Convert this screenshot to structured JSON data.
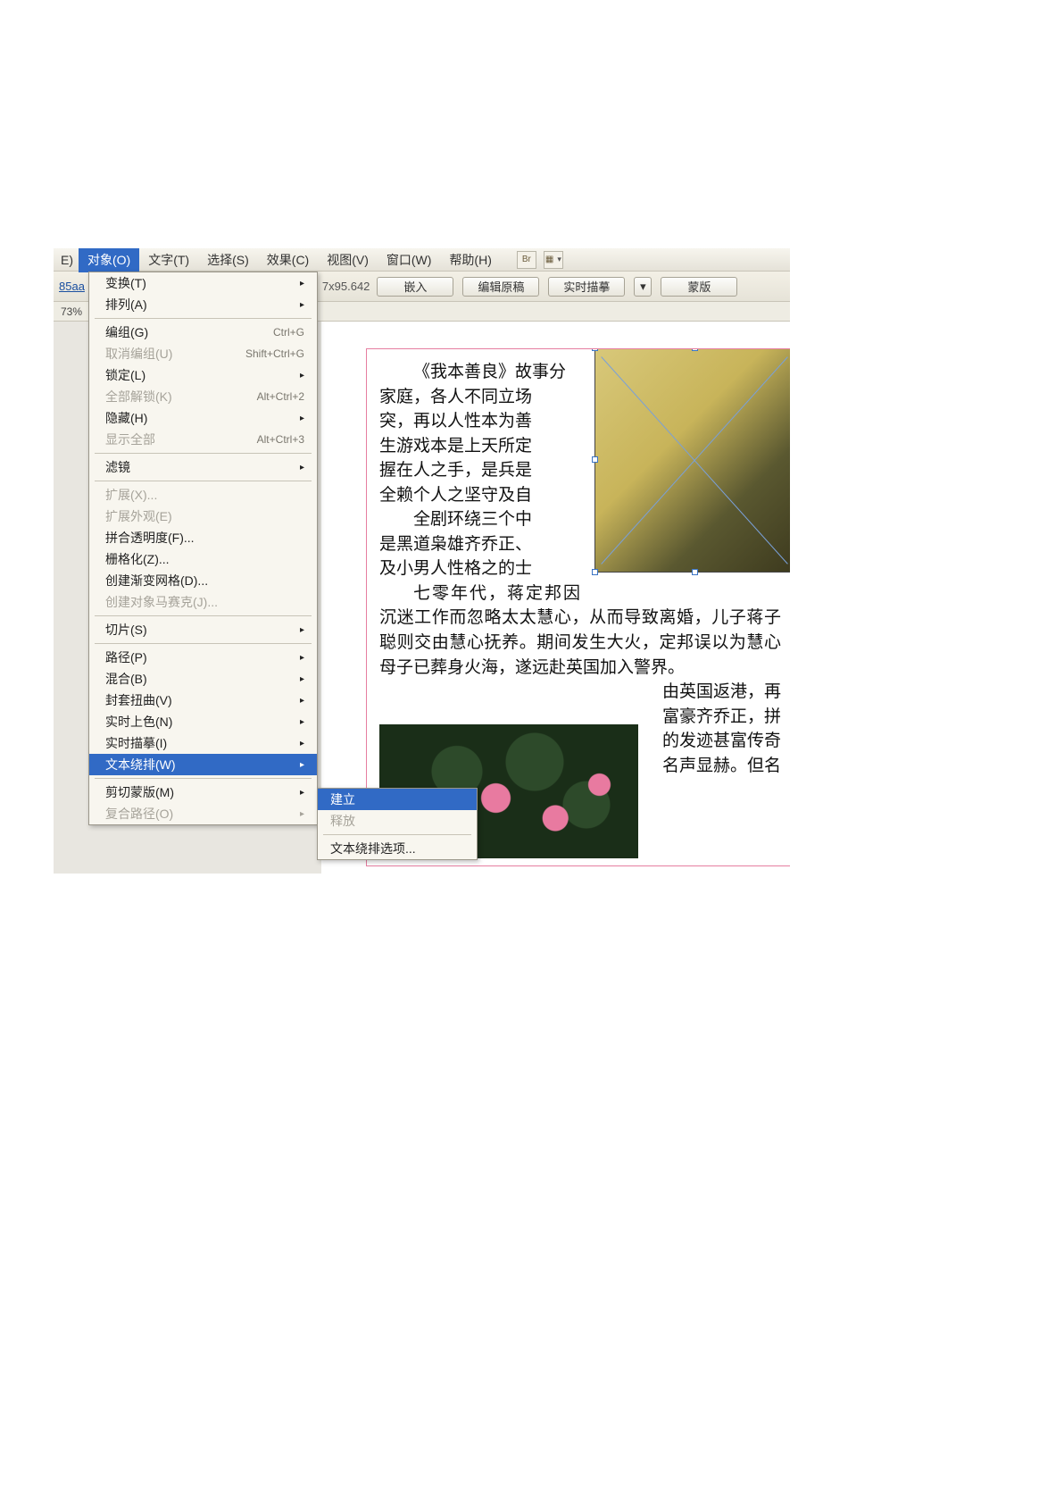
{
  "menubar": {
    "fragment_prev": "E)",
    "items": [
      {
        "label": "对象(O)",
        "active": true
      },
      {
        "label": "文字(T)"
      },
      {
        "label": "选择(S)"
      },
      {
        "label": "效果(C)"
      },
      {
        "label": "视图(V)"
      },
      {
        "label": "窗口(W)"
      },
      {
        "label": "帮助(H)"
      }
    ],
    "icon_br": "Br",
    "icon_layout": "▦"
  },
  "controlbar": {
    "tab_link": "85aa",
    "zoom": "73%",
    "dims": "7x95.642",
    "buttons": {
      "embed": "嵌入",
      "edit_orig": "编辑原稿",
      "live_trace": "实时描摹",
      "mask": "蒙版"
    }
  },
  "dropdown": {
    "items": [
      {
        "label": "变换(T)",
        "submenu": true
      },
      {
        "label": "排列(A)",
        "submenu": true
      },
      {
        "sep": true
      },
      {
        "label": "编组(G)",
        "shortcut": "Ctrl+G"
      },
      {
        "label": "取消编组(U)",
        "shortcut": "Shift+Ctrl+G",
        "disabled": true
      },
      {
        "label": "锁定(L)",
        "submenu": true
      },
      {
        "label": "全部解锁(K)",
        "shortcut": "Alt+Ctrl+2",
        "disabled": true
      },
      {
        "label": "隐藏(H)",
        "submenu": true
      },
      {
        "label": "显示全部",
        "shortcut": "Alt+Ctrl+3",
        "disabled": true
      },
      {
        "sep": true
      },
      {
        "label": "滤镜",
        "submenu": true
      },
      {
        "sep": true
      },
      {
        "label": "扩展(X)...",
        "disabled": true
      },
      {
        "label": "扩展外观(E)",
        "disabled": true
      },
      {
        "label": "拼合透明度(F)..."
      },
      {
        "label": "栅格化(Z)..."
      },
      {
        "label": "创建渐变网格(D)..."
      },
      {
        "label": "创建对象马赛克(J)...",
        "disabled": true
      },
      {
        "sep": true
      },
      {
        "label": "切片(S)",
        "submenu": true
      },
      {
        "sep": true
      },
      {
        "label": "路径(P)",
        "submenu": true
      },
      {
        "label": "混合(B)",
        "submenu": true
      },
      {
        "label": "封套扭曲(V)",
        "submenu": true
      },
      {
        "label": "实时上色(N)",
        "submenu": true
      },
      {
        "label": "实时描摹(I)",
        "submenu": true
      },
      {
        "label": "文本绕排(W)",
        "submenu": true,
        "highlight": true
      },
      {
        "sep": true
      },
      {
        "label": "剪切蒙版(M)",
        "submenu": true
      },
      {
        "label": "复合路径(O)",
        "submenu": true,
        "disabled": true
      }
    ]
  },
  "submenu": {
    "items": [
      {
        "label": "建立",
        "highlight": true
      },
      {
        "label": "释放",
        "disabled": true
      },
      {
        "sep": true
      },
      {
        "label": "文本绕排选项..."
      }
    ]
  },
  "document": {
    "para1_a": "《我本善良》故事分",
    "para1_b": "家庭，各人不同立场",
    "para1_c": "突，再以人性本为善",
    "para1_d": "生游戏本是上天所定",
    "para1_e": "握在人之手，是兵是",
    "para1_f": "全赖个人之坚守及自",
    "para2_a": "全剧环绕三个中",
    "para2_b": "是黑道枭雄齐乔正、",
    "para2_c": "及小男人性格之的士",
    "para3": "七零年代，蒋定邦因沉迷工作而忽略太太慧心，从而导致离婚，儿子蒋子聪则交由慧心抚养。期间发生大火，定邦误以为慧心母子已葬身火海，遂远赴英国加入警界。",
    "para4_a": "由英国返港，再",
    "para4_b": "富豪齐乔正，拼",
    "para4_c": "的发迹甚富传奇",
    "para4_d": "名声显赫。但名"
  }
}
